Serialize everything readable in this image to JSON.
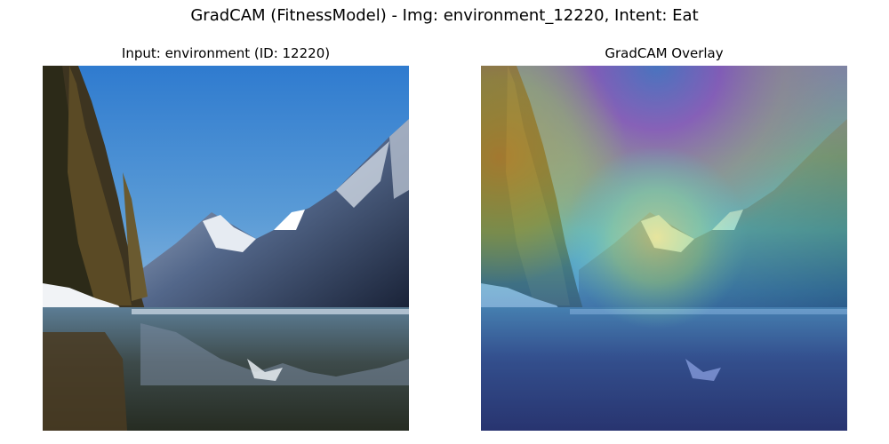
{
  "figure": {
    "suptitle": "GradCAM (FitnessModel) - Img: environment_12220, Intent: Eat"
  },
  "panels": [
    {
      "title": "Input: environment (ID: 12220)",
      "image": "mountain-lake-photo",
      "description_colors": {
        "sky": "#3f86cf",
        "snow": "#eef2f5",
        "water": "#2f3a3a",
        "trees": "#4a3a20"
      }
    },
    {
      "title": "GradCAM Overlay",
      "image": "mountain-lake-photo-with-jet-heatmap",
      "colormap": "jet"
    }
  ]
}
